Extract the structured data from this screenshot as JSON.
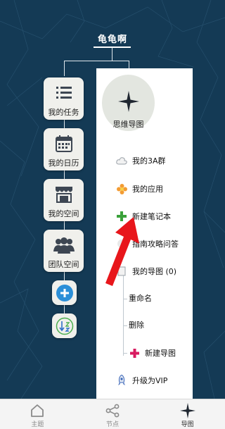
{
  "root": {
    "title": "龟龟啊"
  },
  "tiles": [
    {
      "label": "我的任务",
      "icon": "task-list-icon"
    },
    {
      "label": "我的日历",
      "icon": "calendar-icon"
    },
    {
      "label": "我的空间",
      "icon": "storefront-icon"
    },
    {
      "label": "团队空间",
      "icon": "team-icon"
    }
  ],
  "buttons": {
    "add_icon": "plus-circle-icon",
    "sort_icon": "sort-icon"
  },
  "panel": {
    "center_label": "思维导图",
    "items": [
      {
        "label": "我的3A群",
        "icon": "cloud-icon"
      },
      {
        "label": "我的应用",
        "icon": "flower-icon"
      },
      {
        "label": "新建笔记本",
        "icon": "plus-green-icon"
      },
      {
        "label": "指南攻略问答",
        "icon": "guide-icon"
      },
      {
        "label": "我的导图 (0)",
        "icon": "doc-icon"
      }
    ],
    "subitems": [
      {
        "label": "重命名"
      },
      {
        "label": "删除"
      },
      {
        "label": "新建导图",
        "icon": "plus-pink-icon"
      }
    ],
    "upgrade": {
      "label": "升级为VIP",
      "icon": "rocket-icon"
    }
  },
  "nav": [
    {
      "label": "主题",
      "icon": "home-icon",
      "active": false
    },
    {
      "label": "节点",
      "icon": "share-nodes-icon",
      "active": false
    },
    {
      "label": "导图",
      "icon": "compass-star-icon",
      "active": true
    }
  ],
  "colors": {
    "background": "#143a55",
    "accent_red": "#e8161b",
    "green": "#3aa13a",
    "pink": "#d81b60",
    "blue": "#2b8fd8"
  }
}
